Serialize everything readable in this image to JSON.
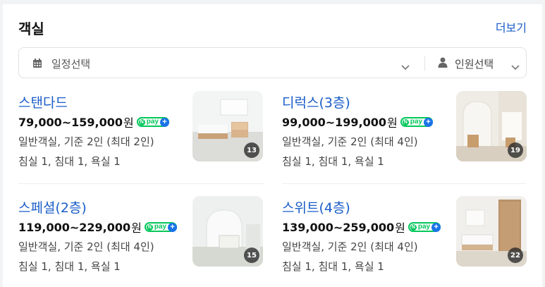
{
  "section": {
    "title": "객실",
    "more_label": "더보기"
  },
  "filters": {
    "date_label": "일정선택",
    "guest_label": "인원선택"
  },
  "rooms": [
    {
      "name": "스탠다드",
      "price": "79,000~159,000",
      "unit": "원",
      "desc": "일반객실, 기준 2인 (최대 2인)",
      "beds": "침실 1, 침대 1, 욕실 1",
      "photos": "13"
    },
    {
      "name": "디럭스(3층)",
      "price": "99,000~199,000",
      "unit": "원",
      "desc": "일반객실, 기준 2인 (최대 4인)",
      "beds": "침실 1, 침대 1, 욕실 1",
      "photos": "19"
    },
    {
      "name": "스페셜(2층)",
      "price": "119,000~229,000",
      "unit": "원",
      "desc": "일반객실, 기준 2인 (최대 4인)",
      "beds": "침실 1, 침대 1, 욕실 1",
      "photos": "15"
    },
    {
      "name": "스위트(4층)",
      "price": "139,000~259,000",
      "unit": "원",
      "desc": "일반객실, 기준 2인 (최대 4인)",
      "beds": "침실 1, 침대 1, 욕실 1",
      "photos": "22"
    }
  ],
  "npay": {
    "n": "N",
    "text": "pay",
    "plus": "+"
  },
  "icons": {
    "calendar": "calendar-icon",
    "person": "person-icon",
    "chevron": "chevron-down-icon"
  },
  "colors": {
    "link": "#1a5dc8",
    "npay_green": "#03c75a",
    "npay_plus_blue": "#1a73e8"
  }
}
